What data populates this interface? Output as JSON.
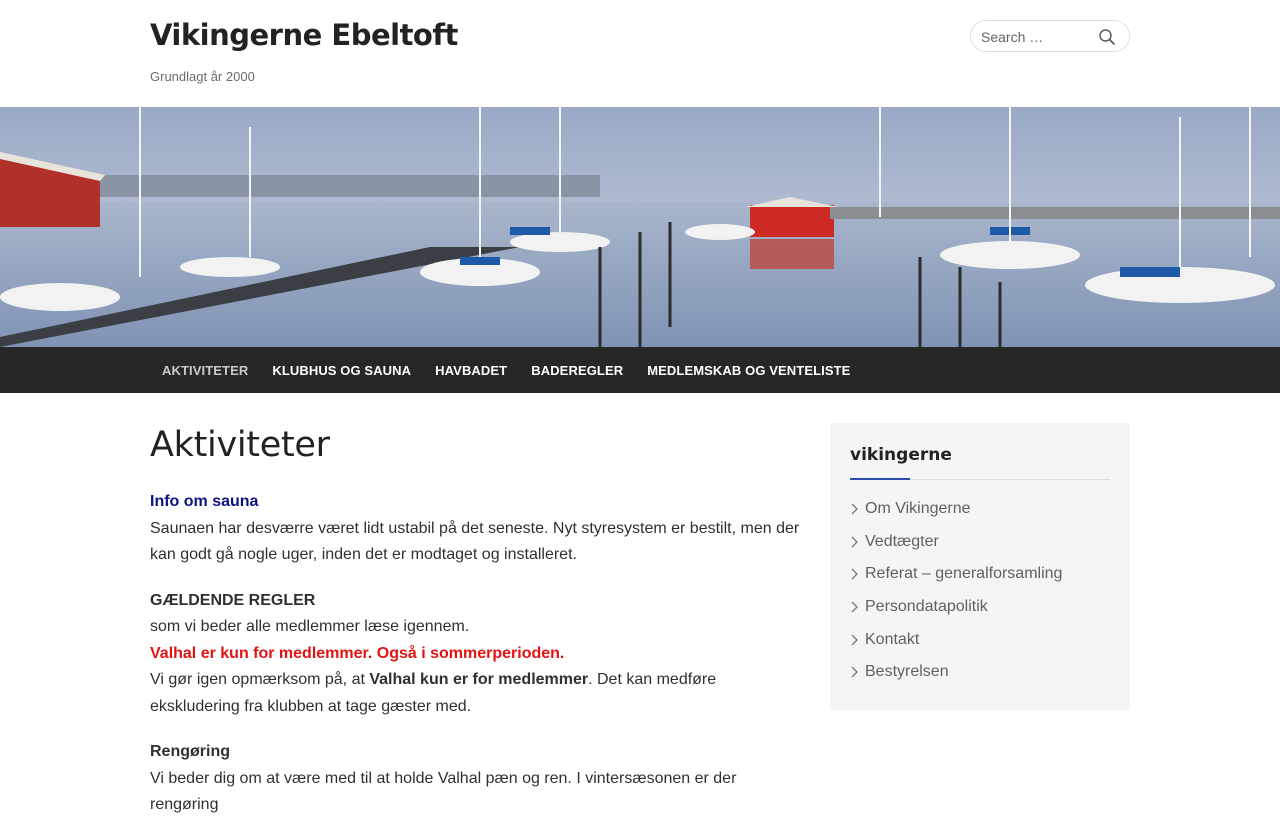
{
  "header": {
    "site_title": "Vikingerne Ebeltoft",
    "tagline": "Grundlagt år 2000",
    "search_placeholder": "Search …"
  },
  "nav": {
    "items": [
      {
        "label": "AKTIVITETER",
        "active": true
      },
      {
        "label": "KLUBHUS OG SAUNA"
      },
      {
        "label": "HAVBADET"
      },
      {
        "label": "BADEREGLER"
      },
      {
        "label": "MEDLEMSKAB OG VENTELISTE"
      }
    ]
  },
  "content": {
    "title": "Aktiviteter",
    "sauna_heading": "Info om sauna",
    "sauna_text": "Saunaen har desværre været lidt ustabil på det seneste. Nyt styresystem er bestilt, men der kan godt gå nogle uger, inden det er modtaget og installeret.",
    "rules_heading": "GÆLDENDE REGLER",
    "rules_text": "som vi beder alle medlemmer læse igennem.",
    "rules_warning": "Valhal er kun for medlemmer. Også i sommerperioden.",
    "rules_note_start": "Vi gør igen opmærksom på, at ",
    "rules_note_bold": "Valhal kun er for medlemmer",
    "rules_note_end": ". Det kan medføre ekskludering fra klubben at tage gæster med.",
    "cleaning_heading": "Rengøring",
    "cleaning_text": "Vi beder dig om at være med til at holde Valhal pæn og ren. I vintersæsonen er der rengøring"
  },
  "sidebar": {
    "widget_title": "vikingerne",
    "items": [
      {
        "label": "Om Vikingerne"
      },
      {
        "label": "Vedtægter"
      },
      {
        "label": "Referat – generalforsamling"
      },
      {
        "label": "Persondatapolitik"
      },
      {
        "label": "Kontakt"
      },
      {
        "label": "Bestyrelsen"
      }
    ]
  },
  "colors": {
    "nav_bg": "#272727",
    "link_blue": "#0b1480",
    "warning_red": "#e41212",
    "accent": "#2b4fa8"
  }
}
